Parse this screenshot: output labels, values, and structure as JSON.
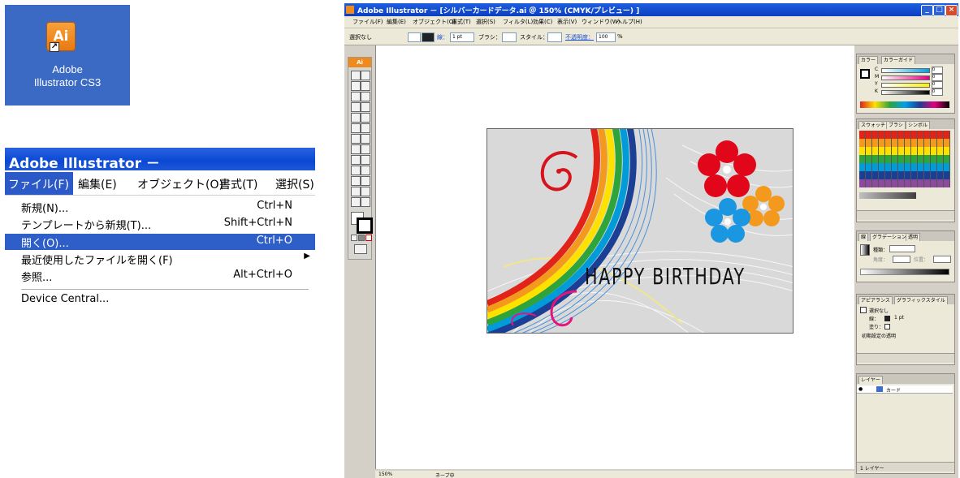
{
  "desktop_icon": {
    "tile_text": "Ai",
    "label_line1": "Adobe",
    "label_line2": "Illustrator CS3"
  },
  "menu_window": {
    "title": "Adobe Illustrator －",
    "menubar": [
      "ファイル(F)",
      "編集(E)",
      "オブジェクト(O)",
      "書式(T)",
      "選択(S)"
    ],
    "items": [
      {
        "label": "新規(N)...",
        "shortcut": "Ctrl+N"
      },
      {
        "label": "テンプレートから新規(T)...",
        "shortcut": "Shift+Ctrl+N"
      },
      {
        "label": "開く(O)...",
        "shortcut": "Ctrl+O"
      },
      {
        "label": "最近使用したファイルを開く(F)",
        "shortcut": "▶"
      },
      {
        "label": "参照...",
        "shortcut": "Alt+Ctrl+O"
      },
      {
        "label": "Device Central...",
        "shortcut": ""
      }
    ]
  },
  "app": {
    "title": "Adobe Illustrator － [シルバーカードデータ.ai ＠ 150% (CMYK/プレビュー) ]",
    "menu": [
      "ファイル(F)",
      "編集(E)",
      "オブジェクト(O)",
      "書式(T)",
      "選択(S)",
      "フィルタ(L)",
      "効果(C)",
      "表示(V)",
      "ウィンドウ(W)",
      "ヘルプ(H)"
    ],
    "control_bar": {
      "selection": "選択なし",
      "stroke_label": "線：",
      "stroke_value": "1 pt",
      "brush_label": "ブラシ：",
      "style_label": "スタイル：",
      "opacity_label": "不透明度：",
      "opacity_value": "100",
      "opacity_unit": "%"
    },
    "tools_label": "Ai",
    "artwork_text": "HAPPY BIRTHDAY",
    "status": {
      "zoom": "150%",
      "status_text": "ネーブ中"
    },
    "panels": {
      "color": {
        "tabs": [
          "カラー",
          "カラーガイド"
        ],
        "channels": [
          "C",
          "M",
          "Y",
          "K"
        ],
        "values": [
          "0",
          "0",
          "0",
          "0"
        ]
      },
      "swatches": {
        "tabs": [
          "スウォッチ",
          "ブラシ",
          "シンボル"
        ]
      },
      "stroke_gradient": {
        "tabs": [
          "線",
          "グラデーション",
          "透明"
        ],
        "type_label": "種類：",
        "angle_label": "角度：",
        "position_label": "位置："
      },
      "appearance": {
        "tabs": [
          "アピアランス",
          "グラフィックスタイル"
        ],
        "selection": "選択なし",
        "stroke_label": "線：",
        "stroke_value": "1 pt",
        "fill_label": "塗り：",
        "opacity_label": "初期設定の透明"
      },
      "layers": {
        "tabs": [
          "レイヤー"
        ],
        "layer_name": "カード",
        "footer": "1 レイヤー"
      }
    }
  }
}
